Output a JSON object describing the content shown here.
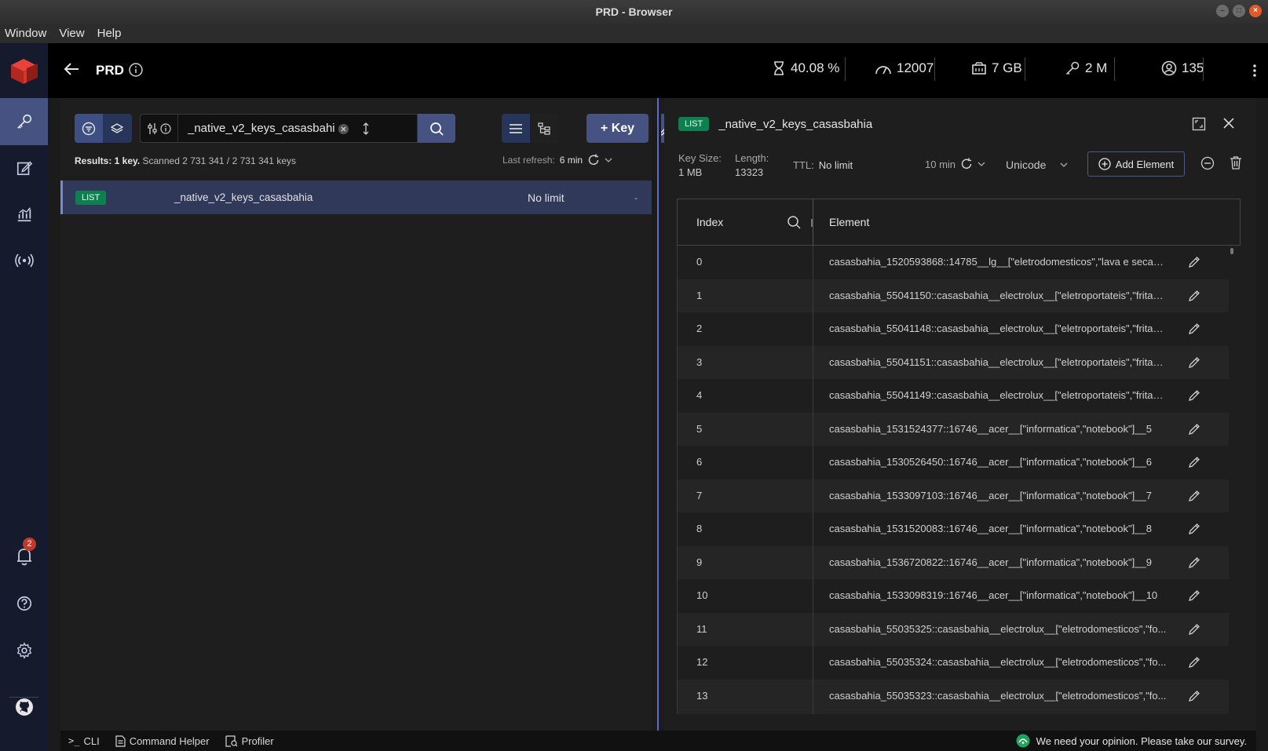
{
  "window": {
    "title": "PRD - Browser"
  },
  "menu": [
    "Window",
    "View",
    "Help"
  ],
  "sidebar": {
    "notifications_count": "2"
  },
  "topbar": {
    "db_name": "PRD",
    "stats": {
      "cpu": "40.08 %",
      "ops": "12007",
      "memory": "7 GB",
      "keys": "2 M",
      "clients": "135"
    }
  },
  "browser": {
    "search_value": "_native_v2_keys_casasbahia",
    "add_key_label": "+ Key",
    "results_prefix": "Results: 1 key.",
    "results_scan": "Scanned 2 731 341 / 2 731 341 keys",
    "last_refresh_label": "Last refresh:",
    "last_refresh_value": "6 min",
    "keys": [
      {
        "type": "LIST",
        "name": "_native_v2_keys_casasbahia",
        "ttl": "No limit",
        "size": "-"
      }
    ]
  },
  "details": {
    "type": "LIST",
    "key_name": "_native_v2_keys_casasbahia",
    "key_size_label": "Key Size:",
    "key_size_value": "1 MB",
    "length_label": "Length:",
    "length_value": "13323",
    "ttl_label": "TTL:",
    "ttl_value": "No limit",
    "refresh_interval": "10 min",
    "encoding": "Unicode",
    "add_element_label": "Add Element",
    "columns": {
      "index": "Index",
      "element": "Element"
    },
    "rows": [
      {
        "index": "0",
        "element": "casasbahia_1520593868::14785__lg__[\"eletrodomesticos\",\"lava e seca\"]_..."
      },
      {
        "index": "1",
        "element": "casasbahia_55041150::casasbahia__electrolux__[\"eletroportateis\",\"fritad..."
      },
      {
        "index": "2",
        "element": "casasbahia_55041148::casasbahia__electrolux__[\"eletroportateis\",\"fritad..."
      },
      {
        "index": "3",
        "element": "casasbahia_55041151::casasbahia__electrolux__[\"eletroportateis\",\"fritad..."
      },
      {
        "index": "4",
        "element": "casasbahia_55041149::casasbahia__electrolux__[\"eletroportateis\",\"fritad..."
      },
      {
        "index": "5",
        "element": "casasbahia_1531524377::16746__acer__[\"informatica\",\"notebook\"]__5"
      },
      {
        "index": "6",
        "element": "casasbahia_1530526450::16746__acer__[\"informatica\",\"notebook\"]__6"
      },
      {
        "index": "7",
        "element": "casasbahia_1533097103::16746__acer__[\"informatica\",\"notebook\"]__7"
      },
      {
        "index": "8",
        "element": "casasbahia_1531520083::16746__acer__[\"informatica\",\"notebook\"]__8"
      },
      {
        "index": "9",
        "element": "casasbahia_1536720822::16746__acer__[\"informatica\",\"notebook\"]__9"
      },
      {
        "index": "10",
        "element": "casasbahia_1533098319::16746__acer__[\"informatica\",\"notebook\"]__10"
      },
      {
        "index": "11",
        "element": "casasbahia_55035325::casasbahia__electrolux__[\"eletrodomesticos\",\"fo..."
      },
      {
        "index": "12",
        "element": "casasbahia_55035324::casasbahia__electrolux__[\"eletrodomesticos\",\"fo..."
      },
      {
        "index": "13",
        "element": "casasbahia_55035323::casasbahia__electrolux__[\"eletrodomesticos\",\"fo..."
      }
    ]
  },
  "statusbar": {
    "cli": "CLI",
    "command_helper": "Command Helper",
    "profiler": "Profiler",
    "survey": "We need your opinion. Please take our survey."
  },
  "colors": {
    "accent": "#465282",
    "list_badge": "#0f7f4f",
    "sidebar": "#151a2d"
  }
}
